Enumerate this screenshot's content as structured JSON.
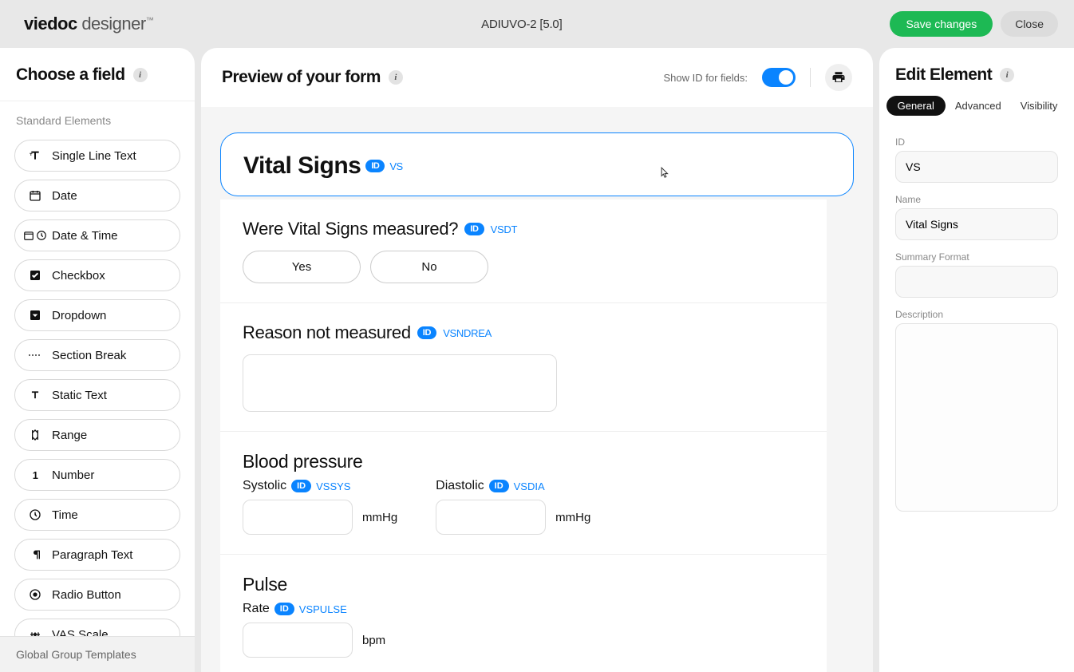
{
  "header": {
    "brand_bold": "viedoc",
    "brand_light": " designer",
    "project": "ADIUVO-2 [5.0]",
    "save": "Save changes",
    "close": "Close"
  },
  "sidebar": {
    "title": "Choose a field",
    "section": "Standard Elements",
    "footer": "Global Group Templates",
    "items": [
      {
        "icon": "text",
        "label": "Single Line Text"
      },
      {
        "icon": "date",
        "label": "Date"
      },
      {
        "icon": "datetime",
        "label": "Date & Time"
      },
      {
        "icon": "checkbox",
        "label": "Checkbox"
      },
      {
        "icon": "dropdown",
        "label": "Dropdown"
      },
      {
        "icon": "section",
        "label": "Section Break"
      },
      {
        "icon": "static",
        "label": "Static Text"
      },
      {
        "icon": "range",
        "label": "Range"
      },
      {
        "icon": "number",
        "label": "Number"
      },
      {
        "icon": "time",
        "label": "Time"
      },
      {
        "icon": "para",
        "label": "Paragraph Text"
      },
      {
        "icon": "radio",
        "label": "Radio Button"
      },
      {
        "icon": "vas",
        "label": "VAS Scale"
      }
    ]
  },
  "preview": {
    "title": "Preview of your form",
    "show_id_label": "Show ID for fields:",
    "id_badge": "ID",
    "form": {
      "title": "Vital Signs",
      "title_id": "VS",
      "q_measured": {
        "label": "Were Vital Signs measured?",
        "id": "VSDT",
        "yes": "Yes",
        "no": "No"
      },
      "q_reason": {
        "label": "Reason not measured",
        "id": "VSNDREA"
      },
      "bp": {
        "title": "Blood pressure",
        "sys": {
          "label": "Systolic",
          "id": "VSSYS",
          "unit": "mmHg"
        },
        "dia": {
          "label": "Diastolic",
          "id": "VSDIA",
          "unit": "mmHg"
        }
      },
      "pulse": {
        "title": "Pulse",
        "label": "Rate",
        "id": "VSPULSE",
        "unit": "bpm"
      }
    }
  },
  "inspector": {
    "title": "Edit Element",
    "tabs": {
      "general": "General",
      "advanced": "Advanced",
      "visibility": "Visibility"
    },
    "fields": {
      "id_label": "ID",
      "id_value": "VS",
      "name_label": "Name",
      "name_value": "Vital Signs",
      "summary_label": "Summary Format",
      "summary_value": "",
      "desc_label": "Description",
      "desc_value": ""
    }
  }
}
